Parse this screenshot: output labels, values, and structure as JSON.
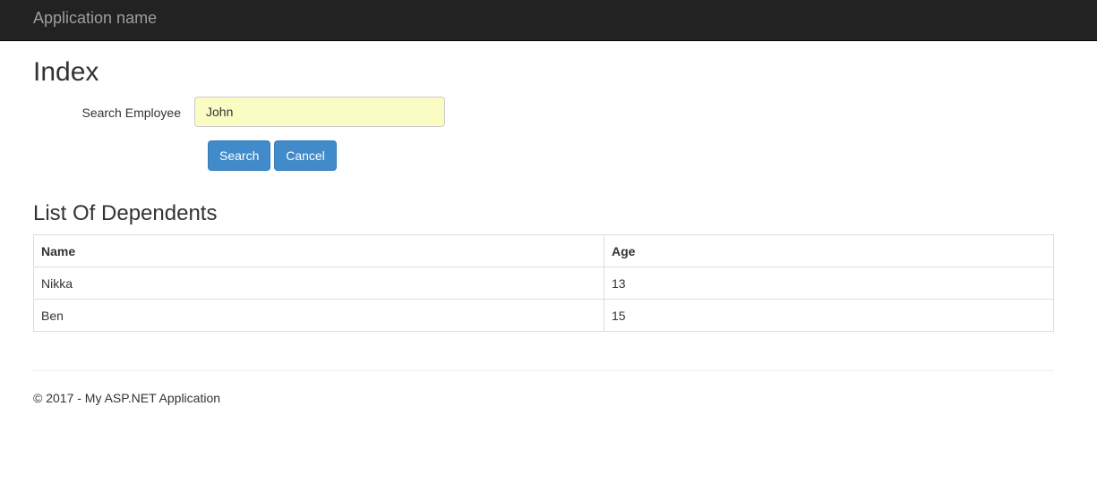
{
  "navbar": {
    "brand": "Application name"
  },
  "page": {
    "title": "Index"
  },
  "search": {
    "label": "Search Employee",
    "value": "John",
    "search_button": "Search",
    "cancel_button": "Cancel"
  },
  "dependents": {
    "title": "List Of Dependents",
    "columns": [
      "Name",
      "Age"
    ],
    "rows": [
      [
        "Nikka",
        "13"
      ],
      [
        "Ben",
        "15"
      ]
    ]
  },
  "footer": {
    "text": "© 2017 - My ASP.NET Application"
  },
  "colors": {
    "navbar_bg": "#222222",
    "brand_text": "#9d9d9d",
    "button_primary": "#428bca",
    "input_autofill_bg": "#fbfbc4"
  }
}
